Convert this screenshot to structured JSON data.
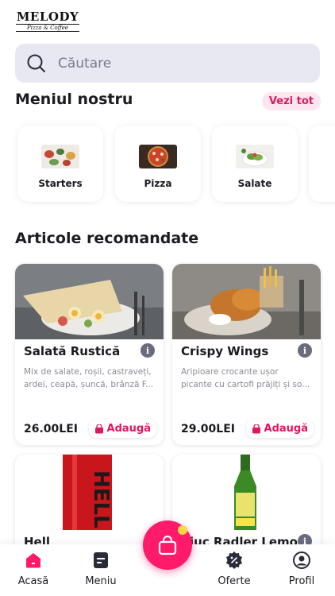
{
  "logo": {
    "main": "MELODY",
    "sub": "Pizza & Coffee"
  },
  "search": {
    "placeholder": "Căutare"
  },
  "menu": {
    "title": "Meniul nostru",
    "see_all": "Vezi tot",
    "categories": [
      {
        "label": "Starters",
        "icon": "starters-photo"
      },
      {
        "label": "Pizza",
        "icon": "pizza-photo"
      },
      {
        "label": "Salate",
        "icon": "salad-photo"
      }
    ]
  },
  "recommended": {
    "title": "Articole recomandate",
    "items": [
      {
        "name": "Salată Rustică",
        "desc": "Mix de salate, roșii, castraveți, ardei, ceapă, șuncă, brânză F...",
        "price": "26.00LEI",
        "add": "Adaugă"
      },
      {
        "name": "Crispy Wings",
        "desc": "Aripioare crocante ușor picante cu cartofi prăjiți și so...",
        "price": "29.00LEI",
        "add": "Adaugă"
      },
      {
        "name": "Hell",
        "desc": "",
        "price": "",
        "add": ""
      },
      {
        "name": "Ciuc Radler Lemon",
        "desc": "",
        "price": "",
        "add": ""
      }
    ]
  },
  "tabs": [
    {
      "label": "Acasă",
      "icon": "home-icon"
    },
    {
      "label": "Meniu",
      "icon": "menu-icon"
    },
    {
      "label": "Oferte",
      "icon": "offers-icon"
    },
    {
      "label": "Profil",
      "icon": "profile-icon"
    }
  ],
  "colors": {
    "accent": "#e0175f",
    "fab": "#ff1a6a",
    "badge": "#ffd54a"
  }
}
